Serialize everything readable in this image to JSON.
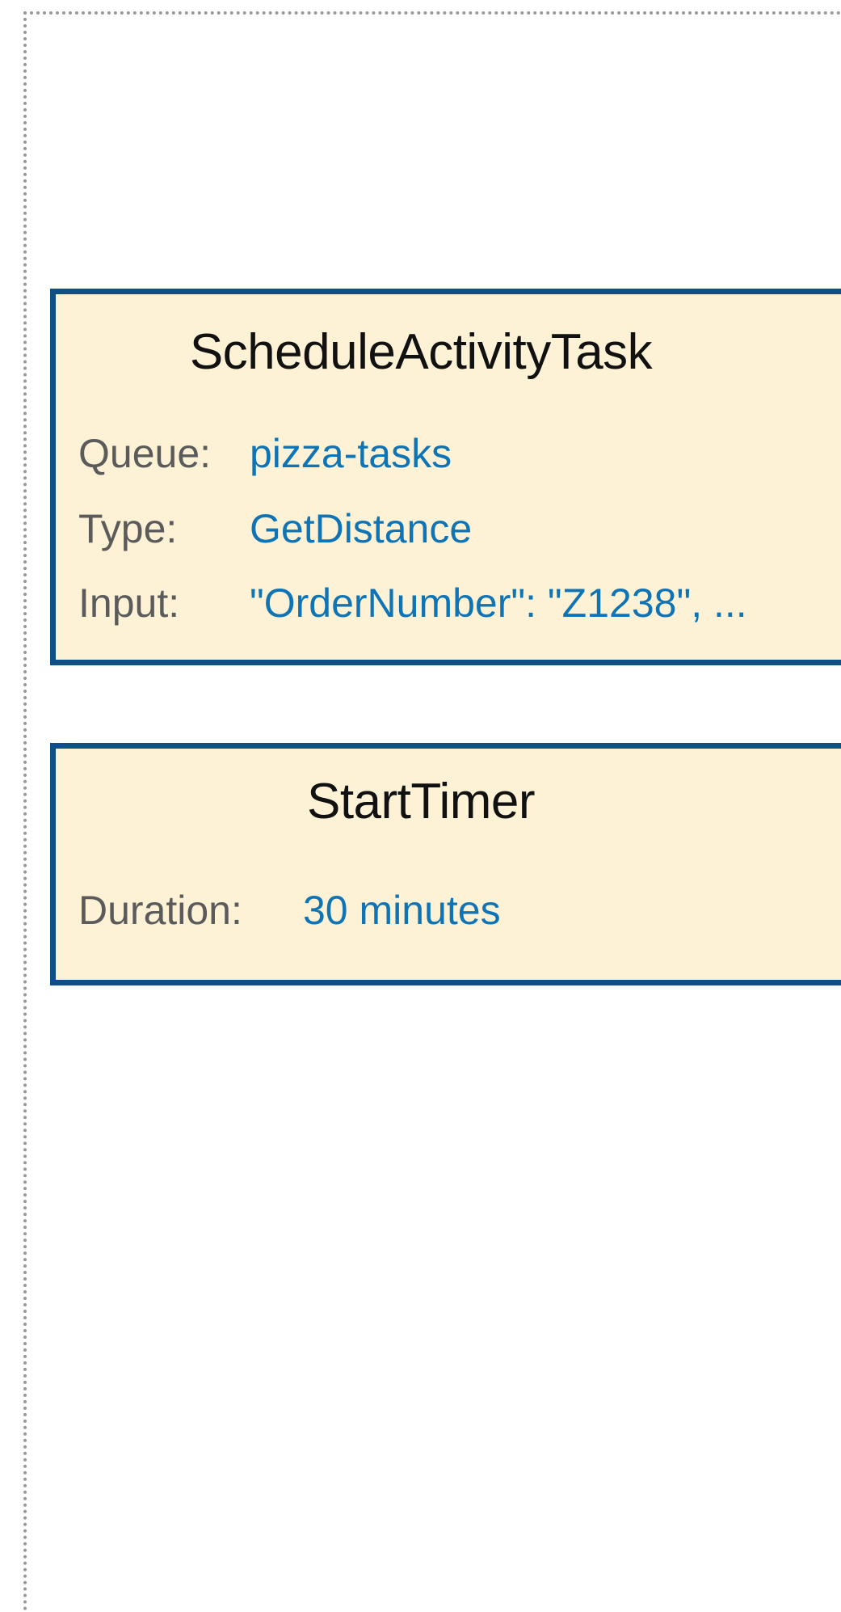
{
  "commands": {
    "schedule": {
      "title": "ScheduleActivityTask",
      "queue_label": "Queue:",
      "queue_value": "pizza-tasks",
      "type_label": "Type:",
      "type_value": "GetDistance",
      "input_label": "Input:",
      "input_value": "\"OrderNumber\": \"Z1238\", ..."
    },
    "timer": {
      "title": "StartTimer",
      "duration_label": "Duration:",
      "duration_value": "30 minutes"
    }
  },
  "colors": {
    "card_fill": "#fdf2d6",
    "card_border": "#0f4f86",
    "label_text": "#5b5b5b",
    "value_text": "#0f74b6",
    "frame_border": "#999999"
  }
}
